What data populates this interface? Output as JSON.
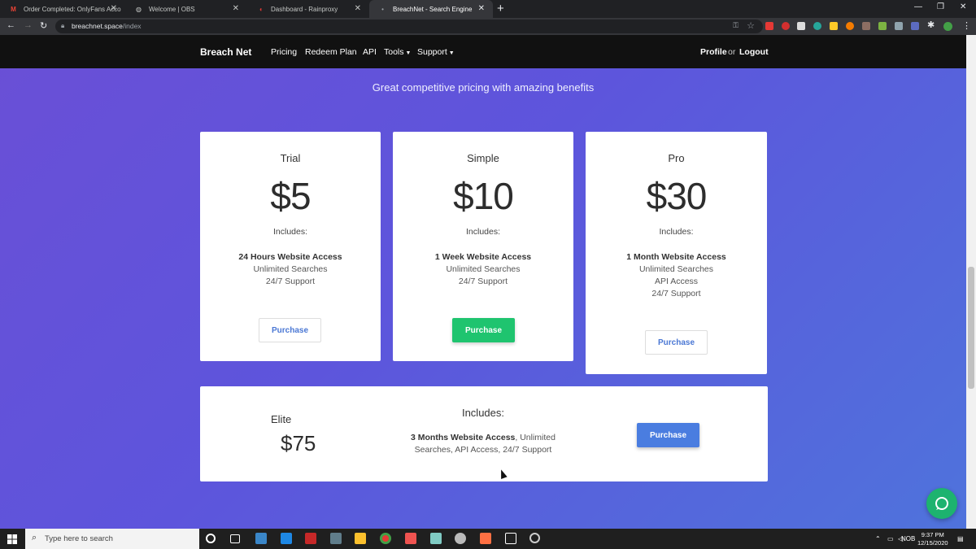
{
  "browser": {
    "tabs": [
      {
        "title": "Order Completed: OnlyFans Acco",
        "icon": "gmail-icon"
      },
      {
        "title": "Welcome | OBS",
        "icon": "globe-icon"
      },
      {
        "title": "Dashboard - Rainproxy",
        "icon": "rainproxy-icon"
      },
      {
        "title": "BreachNet - Search Engine",
        "icon": "breachnet-icon"
      }
    ],
    "address": {
      "host": "breachnet.space",
      "path": "/index"
    }
  },
  "site": {
    "brand": "Breach Net",
    "nav": [
      "Pricing",
      "Redeem Plan",
      "API",
      "Tools",
      "Support"
    ],
    "profile": "Profile",
    "or": "or",
    "logout": "Logout",
    "subtitle": "Great competitive pricing with amazing benefits",
    "plans": [
      {
        "name": "Trial",
        "price": "$5",
        "includes": "Includes:",
        "bold": "24 Hours Website Access",
        "features": [
          "Unlimited Searches",
          "24/7 Support"
        ],
        "button": "Purchase"
      },
      {
        "name": "Simple",
        "price": "$10",
        "includes": "Includes:",
        "bold": "1 Week Website Access",
        "features": [
          "Unlimited Searches",
          "24/7 Support"
        ],
        "button": "Purchase"
      },
      {
        "name": "Pro",
        "price": "$30",
        "includes": "Includes:",
        "bold": "1 Month Website Access",
        "features": [
          "Unlimited Searches",
          "API Access",
          "24/7 Support"
        ],
        "button": "Purchase"
      }
    ],
    "elite": {
      "name": "Elite",
      "price": "$75",
      "includes": "Includes:",
      "bold": "3 Months Website Access",
      "rest": ", Unlimited Searches, API Access, 24/7 Support",
      "button": "Purchase"
    }
  },
  "taskbar": {
    "search_placeholder": "Type here to search",
    "time": "9:37 PM",
    "date": "12/15/2020",
    "lang": "NOB"
  },
  "colors": {
    "accent_green": "#1fc46f",
    "accent_blue": "#4a7de0",
    "navbar": "#111111"
  }
}
